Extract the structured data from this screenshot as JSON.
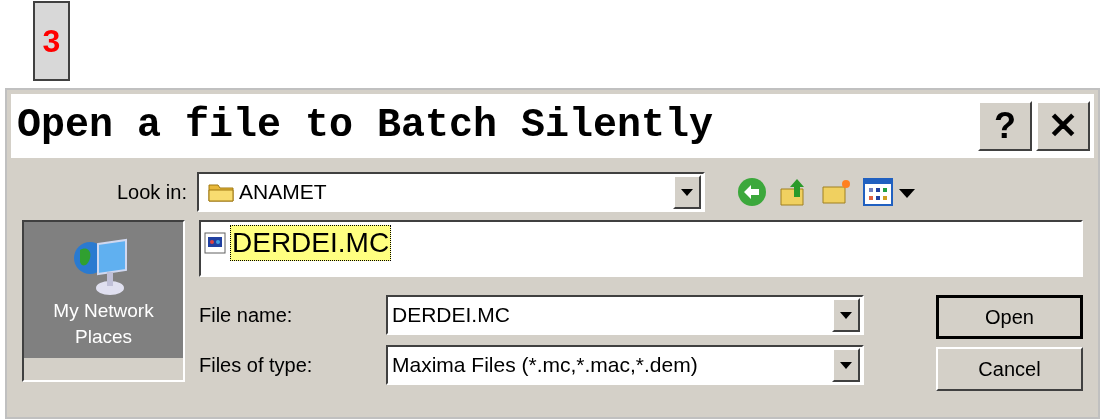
{
  "step_badge": "3",
  "window": {
    "title": "Open a file to Batch Silently",
    "title_buttons": [
      "?",
      "✕"
    ]
  },
  "look_in": {
    "label": "Look in:",
    "value": "ANAMET"
  },
  "places": [
    {
      "label": "My Network Places",
      "selected": true
    }
  ],
  "files": [
    {
      "name": "DERDEI.MC",
      "selected": true
    }
  ],
  "file_name": {
    "label": "File name:",
    "value": "DERDEI.MC"
  },
  "file_type": {
    "label": "Files of type:",
    "value": "Maxima Files (*.mc,*.mac,*.dem)"
  },
  "buttons": [
    {
      "label": "Open",
      "default": true
    },
    {
      "label": "Cancel",
      "default": false
    }
  ]
}
